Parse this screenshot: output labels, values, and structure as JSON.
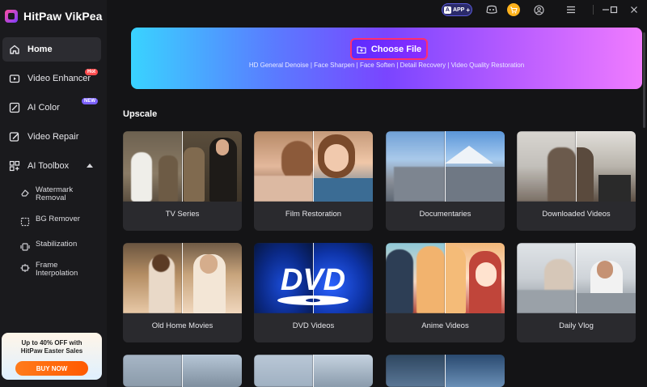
{
  "app": {
    "name": "HitPaw VikPea"
  },
  "topbar": {
    "app_badge": "APP",
    "icons": [
      "app-icon",
      "discord-icon",
      "cart-icon",
      "user-icon",
      "menu-icon",
      "minimize-icon",
      "maximize-icon",
      "close-icon"
    ]
  },
  "sidebar": {
    "items": [
      {
        "label": "Home",
        "icon": "home-icon",
        "active": true
      },
      {
        "label": "Video Enhancer",
        "icon": "video-enhancer-icon",
        "badge": "Hot"
      },
      {
        "label": "AI Color",
        "icon": "ai-color-icon",
        "badge": "NEW"
      },
      {
        "label": "Video Repair",
        "icon": "video-repair-icon"
      },
      {
        "label": "AI Toolbox",
        "icon": "toolbox-icon"
      }
    ],
    "toolbox": [
      {
        "label": "Watermark Removal",
        "icon": "eraser-icon"
      },
      {
        "label": "BG Remover",
        "icon": "bg-remover-icon"
      },
      {
        "label": "Stabilization",
        "icon": "stabilization-icon"
      },
      {
        "label": "Frame Interpolation",
        "icon": "frame-interpolation-icon"
      }
    ],
    "promo": {
      "line1": "Up to 40% OFF with",
      "line2": "HitPaw Easter Sales",
      "button": "BUY NOW"
    }
  },
  "hero": {
    "button": "Choose File",
    "subtitle": "HD General Denoise | Face Sharpen | Face Soften | Detail Recovery | Video Quality Restoration"
  },
  "section": {
    "title": "Upscale"
  },
  "cards": [
    {
      "label": "TV Series"
    },
    {
      "label": "Film Restoration"
    },
    {
      "label": "Documentaries"
    },
    {
      "label": "Downloaded Videos"
    },
    {
      "label": "Old Home Movies"
    },
    {
      "label": "DVD Videos"
    },
    {
      "label": "Anime Videos"
    },
    {
      "label": "Daily Vlog"
    }
  ],
  "colors": {
    "accent": "#7a45ff",
    "highlight_border": "#ff2e6e",
    "sidebar_bg": "#1a1a1d",
    "main_bg": "#141416"
  }
}
